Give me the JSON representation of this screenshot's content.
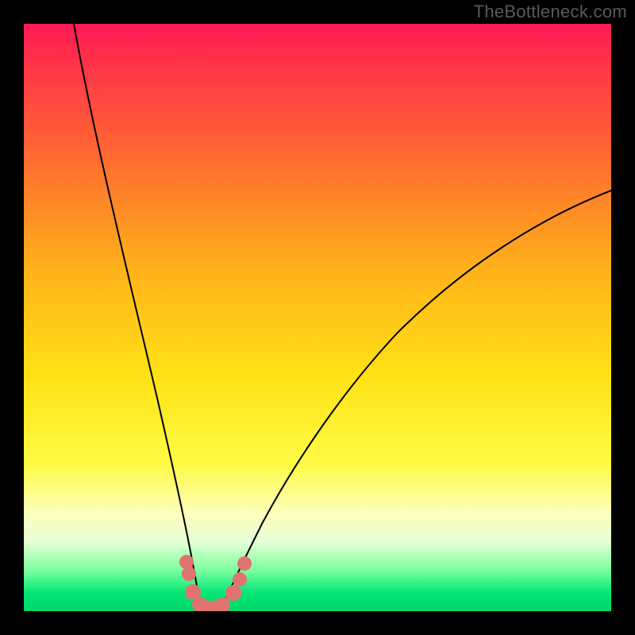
{
  "attribution": "TheBottleneck.com",
  "chart_data": {
    "type": "line",
    "title": "",
    "xlabel": "",
    "ylabel": "",
    "xlim": [
      0,
      1
    ],
    "ylim": [
      0,
      1
    ],
    "background_gradient": {
      "orientation": "vertical",
      "stops": [
        {
          "pos": 0.0,
          "color": "#ff1a55"
        },
        {
          "pos": 0.5,
          "color": "#ffd220"
        },
        {
          "pos": 0.82,
          "color": "#feff9a"
        },
        {
          "pos": 1.0,
          "color": "#00d66a"
        }
      ]
    },
    "series": [
      {
        "name": "left-branch",
        "x": [
          0.085,
          0.12,
          0.16,
          0.2,
          0.23,
          0.255,
          0.275,
          0.29,
          0.3
        ],
        "y": [
          1.0,
          0.8,
          0.55,
          0.33,
          0.18,
          0.09,
          0.04,
          0.015,
          0.0
        ]
      },
      {
        "name": "right-branch",
        "x": [
          0.335,
          0.36,
          0.4,
          0.46,
          0.55,
          0.66,
          0.8,
          0.92,
          1.0
        ],
        "y": [
          0.0,
          0.045,
          0.12,
          0.23,
          0.37,
          0.5,
          0.61,
          0.68,
          0.72
        ]
      }
    ],
    "markers": {
      "name": "bottom-cluster",
      "color": "#e1736f",
      "points": [
        {
          "x": 0.278,
          "y": 0.085
        },
        {
          "x": 0.282,
          "y": 0.065
        },
        {
          "x": 0.288,
          "y": 0.032
        },
        {
          "x": 0.3,
          "y": 0.01
        },
        {
          "x": 0.318,
          "y": 0.004
        },
        {
          "x": 0.338,
          "y": 0.01
        },
        {
          "x": 0.356,
          "y": 0.034
        },
        {
          "x": 0.368,
          "y": 0.058
        },
        {
          "x": 0.376,
          "y": 0.082
        }
      ]
    }
  }
}
